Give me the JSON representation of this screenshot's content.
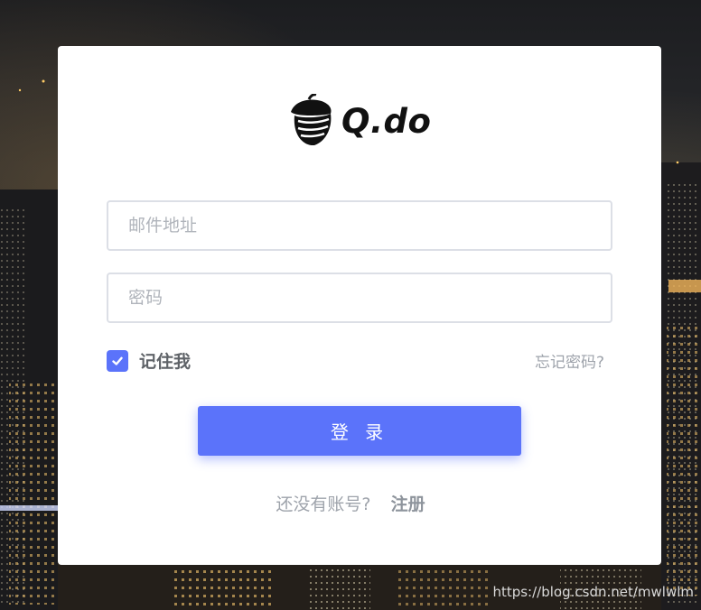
{
  "brand": {
    "logo_text": "Q.do",
    "icon": "acorn-icon"
  },
  "form": {
    "email_placeholder": "邮件地址",
    "password_placeholder": "密码",
    "remember_label": "记住我",
    "remember_checked": true,
    "forgot_label": "忘记密码?",
    "login_label": "登 录",
    "signup_prompt": "还没有账号?",
    "signup_label": "注册"
  },
  "watermark": "https://blog.csdn.net/mwlwlm",
  "colors": {
    "accent": "#5b73fa",
    "card": "#ffffff",
    "muted_text": "#9ea3ab",
    "label_text": "#5f6368"
  }
}
